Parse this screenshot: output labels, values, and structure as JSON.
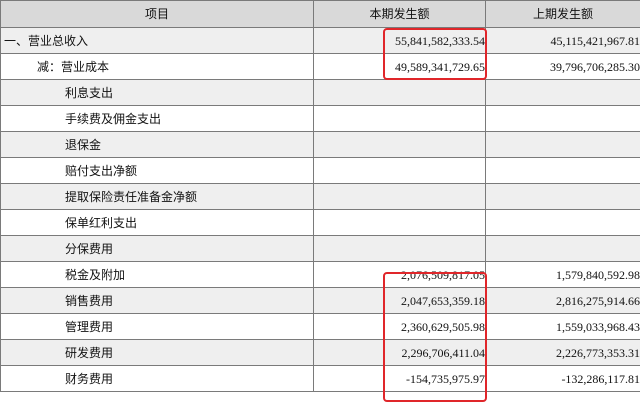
{
  "header": {
    "item": "项目",
    "current": "本期发生额",
    "previous": "上期发生额"
  },
  "rows": [
    {
      "item": "一、营业总收入",
      "level": 0,
      "current": "55,841,582,333.54",
      "previous": "45,115,421,967.81",
      "highlight": true
    },
    {
      "item": "减：营业成本",
      "level": 1,
      "current": "49,589,341,729.65",
      "previous": "39,796,706,285.30",
      "highlight": true
    },
    {
      "item": "利息支出",
      "level": 2,
      "current": "",
      "previous": "",
      "highlight": false
    },
    {
      "item": "手续费及佣金支出",
      "level": 2,
      "current": "",
      "previous": "",
      "highlight": false
    },
    {
      "item": "退保金",
      "level": 2,
      "current": "",
      "previous": "",
      "highlight": false
    },
    {
      "item": "赔付支出净额",
      "level": 2,
      "current": "",
      "previous": "",
      "highlight": false
    },
    {
      "item": "提取保险责任准备金净额",
      "level": 2,
      "current": "",
      "previous": "",
      "highlight": false
    },
    {
      "item": "保单红利支出",
      "level": 2,
      "current": "",
      "previous": "",
      "highlight": false
    },
    {
      "item": "分保费用",
      "level": 2,
      "current": "",
      "previous": "",
      "highlight": false
    },
    {
      "item": "税金及附加",
      "level": 2,
      "current": "2,076,509,817.05",
      "previous": "1,579,840,592.98",
      "highlight": true
    },
    {
      "item": "销售费用",
      "level": 2,
      "current": "2,047,653,359.18",
      "previous": "2,816,275,914.66",
      "highlight": true
    },
    {
      "item": "管理费用",
      "level": 2,
      "current": "2,360,629,505.98",
      "previous": "1,559,033,968.43",
      "highlight": true
    },
    {
      "item": "研发费用",
      "level": 2,
      "current": "2,296,706,411.04",
      "previous": "2,226,773,353.31",
      "highlight": true
    },
    {
      "item": "财务费用",
      "level": 2,
      "current": "-154,735,975.97",
      "previous": "-132,286,117.81",
      "highlight": true
    }
  ],
  "colors": {
    "header_bg": "#d9d9d9",
    "row_shade": "#efefef",
    "grid": "#7a7a7a",
    "highlight_border": "#e0262a"
  }
}
